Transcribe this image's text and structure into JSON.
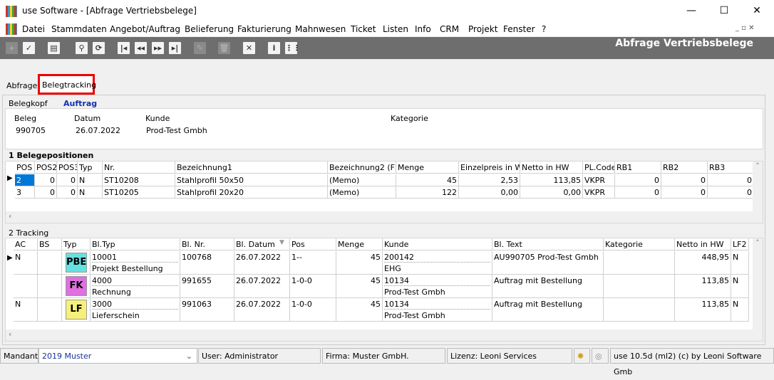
{
  "window": {
    "title": "use Software - [Abfrage Vertriebsbelege]",
    "minimize": "—",
    "maximize": "☐",
    "close": "✕"
  },
  "menu": [
    "Datei",
    "Stammdaten",
    "Angebot/Auftrag",
    "Belieferung",
    "Fakturierung",
    "Mahnwesen",
    "Ticket",
    "Listen",
    "Info",
    "CRM",
    "Projekt",
    "Fenster",
    "?"
  ],
  "toolbar": {
    "title": "Abfrage Vertriebsbelege",
    "icons": [
      "plus-icon",
      "check-icon",
      "print-icon",
      "search-icon",
      "refresh-icon",
      "first-icon",
      "prev-icon",
      "next-icon",
      "last-icon",
      "edit-icon",
      "delete-icon",
      "cancel-icon",
      "info-icon",
      "grid-icon"
    ]
  },
  "tabs": [
    "Abfrage",
    "Belegtracking"
  ],
  "belegkopf": {
    "label": "Belegkopf",
    "type": "Auftrag",
    "headers": [
      "Beleg",
      "Datum",
      "Kunde",
      "Kategorie"
    ],
    "values": [
      "990705",
      "26.07.2022",
      "Prod-Test Gmbh",
      ""
    ]
  },
  "positions": {
    "title": "1 Belegepositionen",
    "columns": [
      "POS",
      "POS2",
      "POS3",
      "Typ",
      "Nr.",
      "Bezeichnung1",
      "Bezeichnung2 (F2)",
      "Menge",
      "Einzelpreis in WC",
      "Netto in HW",
      "PL.Code",
      "RB1",
      "RB2",
      "RB3"
    ],
    "rows": [
      [
        "2",
        "0",
        "0",
        "N",
        "ST10208",
        "Stahlprofil 50x50",
        "(Memo)",
        "45",
        "2,53",
        "113,85",
        "VKPR",
        "0",
        "0",
        "0"
      ],
      [
        "3",
        "0",
        "0",
        "N",
        "ST10205",
        "Stahlprofil 20x20",
        "(Memo)",
        "122",
        "0,00",
        "0,00",
        "VKPR",
        "0",
        "0",
        "0"
      ]
    ]
  },
  "tracking": {
    "title": "2 Tracking",
    "columns": [
      "AC",
      "BS",
      "Typ",
      "Bl.Typ",
      "Bl. Nr.",
      "Bl. Datum",
      "Pos",
      "Menge",
      "Kunde",
      "Bl. Text",
      "Kategorie",
      "Netto in HW",
      "LF2"
    ],
    "rows": [
      {
        "ac": "N",
        "bs": "",
        "typ": "PBE",
        "color": "#66e0e0",
        "bltyp": "10001",
        "bltyp2": "Projekt Bestellung",
        "nr": "100768",
        "datum": "26.07.2022",
        "pos": "1--",
        "menge": "45",
        "kunde": "200142",
        "kunde2": "EHG",
        "text": "AU990705 Prod-Test Gmbh",
        "kat": "",
        "netto": "448,95",
        "lf2": "N"
      },
      {
        "ac": "",
        "bs": "",
        "typ": "FK",
        "color": "#e070e0",
        "bltyp": "4000",
        "bltyp2": "Rechnung",
        "nr": "991655",
        "datum": "26.07.2022",
        "pos": "1-0-0",
        "menge": "45",
        "kunde": "10134",
        "kunde2": "Prod-Test Gmbh",
        "text": "Auftrag mit Bestellung",
        "kat": "",
        "netto": "113,85",
        "lf2": "N"
      },
      {
        "ac": "N",
        "bs": "",
        "typ": "LF",
        "color": "#f6f07a",
        "bltyp": "3000",
        "bltyp2": "Lieferschein",
        "nr": "991063",
        "datum": "26.07.2022",
        "pos": "1-0-0",
        "menge": "45",
        "kunde": "10134",
        "kunde2": "Prod-Test Gmbh",
        "text": "Auftrag mit Bestellung",
        "kat": "",
        "netto": "113,85",
        "lf2": "N"
      }
    ]
  },
  "status": {
    "mandant_label": "Mandant",
    "mandant": "2019 Muster",
    "user": "User: Administrator",
    "firma": "Firma: Muster GmbH.",
    "lizenz": "Lizenz: Leoni Services",
    "version": "use 10.5d (ml2) (c) by Leoni Software Gmb"
  }
}
